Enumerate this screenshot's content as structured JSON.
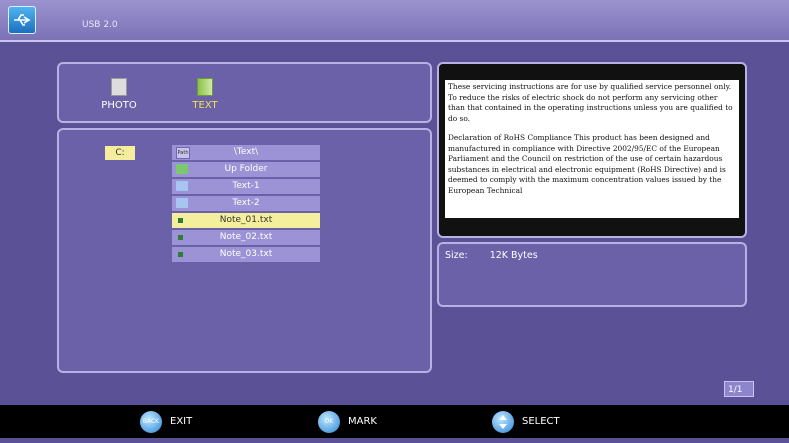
{
  "header": {
    "title": "USB 2.0",
    "logo_icon": "usb-icon"
  },
  "sources": [
    {
      "label": "PHOTO",
      "icon": "photo-icon",
      "active": false
    },
    {
      "label": "TEXT",
      "icon": "text-file-icon",
      "active": true
    }
  ],
  "browser": {
    "drive": "C:",
    "rows": [
      {
        "label": "\\Text\\",
        "icon": "path-icon"
      },
      {
        "label": "Up Folder",
        "icon": "up-folder-icon"
      },
      {
        "label": "Text-1",
        "icon": "folder-icon"
      },
      {
        "label": "Text-2",
        "icon": "folder-icon"
      },
      {
        "label": "Note_01.txt",
        "icon": "file-icon",
        "selected": true
      },
      {
        "label": "Note_02.txt",
        "icon": "file-icon"
      },
      {
        "label": "Note_03.txt",
        "icon": "file-icon"
      }
    ]
  },
  "preview": {
    "paragraphs": [
      "These servicing instructions are for use by qualified service personnel only. To reduce the risks of electric shock do not perform any servicing other than that contained in the operating instructions unless you are qualified to do so.",
      "Declaration of RoHS Compliance This product has been designed and manufactured in compliance with Directive 2002/95/EC of the European Parliament and the Council on restriction of the use of certain hazardous substances in electrical and electronic equipment (RoHS Directive) and is deemed to comply with the maximum concentration values issued by the European Technical"
    ]
  },
  "info": {
    "size_label": "Size:",
    "size_value": "12K Bytes"
  },
  "page_indicator": "1/1",
  "footer": {
    "hints": [
      {
        "button": "BACK",
        "label": "EXIT"
      },
      {
        "button": "OK",
        "label": "MARK"
      },
      {
        "button": "",
        "label": "SELECT",
        "icon": "arrows-icon"
      }
    ]
  },
  "colors": {
    "background": "#5a5196",
    "panel": "#6a61a8",
    "selected_row": "#f4ef9c",
    "row": "#9b93d6",
    "active_source": "#f4e24a"
  }
}
